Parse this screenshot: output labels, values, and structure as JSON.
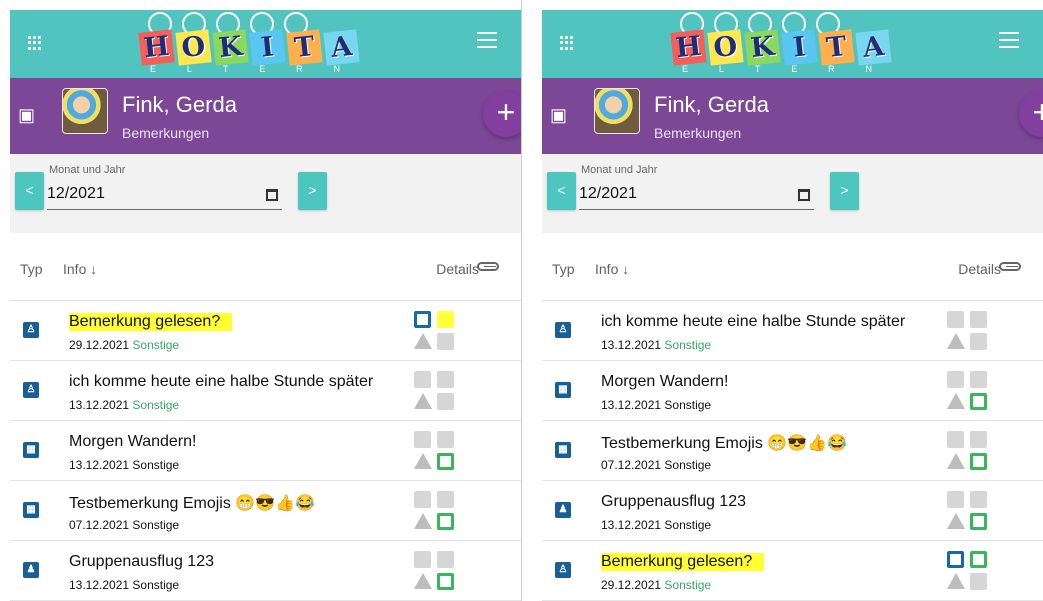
{
  "app": {
    "logo_letters": [
      "H",
      "O",
      "K",
      "I",
      "T",
      "A"
    ],
    "logo_subtitle": [
      "E",
      "L",
      "T",
      "E",
      "R",
      "N"
    ]
  },
  "profile": {
    "name": "Fink, Gerda",
    "section": "Bemerkungen",
    "add_label": "+"
  },
  "filter": {
    "label": "Monat und Jahr",
    "value": "12/2021",
    "prev_label": "<",
    "next_label": ">"
  },
  "table": {
    "headers": {
      "type": "Typ",
      "info": "Info ↓",
      "details": "Details"
    }
  },
  "left_rows": [
    {
      "title": "Bemerkung gelesen?",
      "date": "29.12.2021",
      "category": "Sonstige",
      "category_color": "green",
      "highlight": true
    },
    {
      "title": "ich komme heute eine halbe Stunde später",
      "date": "13.12.2021",
      "category": "Sonstige",
      "category_color": "green",
      "highlight": false
    },
    {
      "title": "Morgen Wandern!",
      "date": "13.12.2021",
      "category": "Sonstige",
      "category_color": "black",
      "highlight": false
    },
    {
      "title": "Testbemerkung Emojis 😁😎👍😂",
      "date": "07.12.2021",
      "category": "Sonstige",
      "category_color": "black",
      "highlight": false
    },
    {
      "title": "Gruppenausflug 123",
      "date": "13.12.2021",
      "category": "Sonstige",
      "category_color": "black",
      "highlight": false
    }
  ],
  "right_rows": [
    {
      "title": "ich komme heute eine halbe Stunde später",
      "date": "13.12.2021",
      "category": "Sonstige",
      "category_color": "green",
      "highlight": false
    },
    {
      "title": "Morgen Wandern!",
      "date": "13.12.2021",
      "category": "Sonstige",
      "category_color": "black",
      "highlight": false
    },
    {
      "title": "Testbemerkung Emojis 😁😎👍😂",
      "date": "07.12.2021",
      "category": "Sonstige",
      "category_color": "black",
      "highlight": false
    },
    {
      "title": "Gruppenausflug 123",
      "date": "13.12.2021",
      "category": "Sonstige",
      "category_color": "black",
      "highlight": false
    },
    {
      "title": "Bemerkung gelesen?",
      "date": "29.12.2021",
      "category": "Sonstige",
      "category_color": "green",
      "highlight": true
    }
  ],
  "colors": {
    "teal": "#52c4c0",
    "purple": "#7b4796",
    "highlight": "#ffff32",
    "green": "#37a86a",
    "blue": "#185f9a"
  }
}
